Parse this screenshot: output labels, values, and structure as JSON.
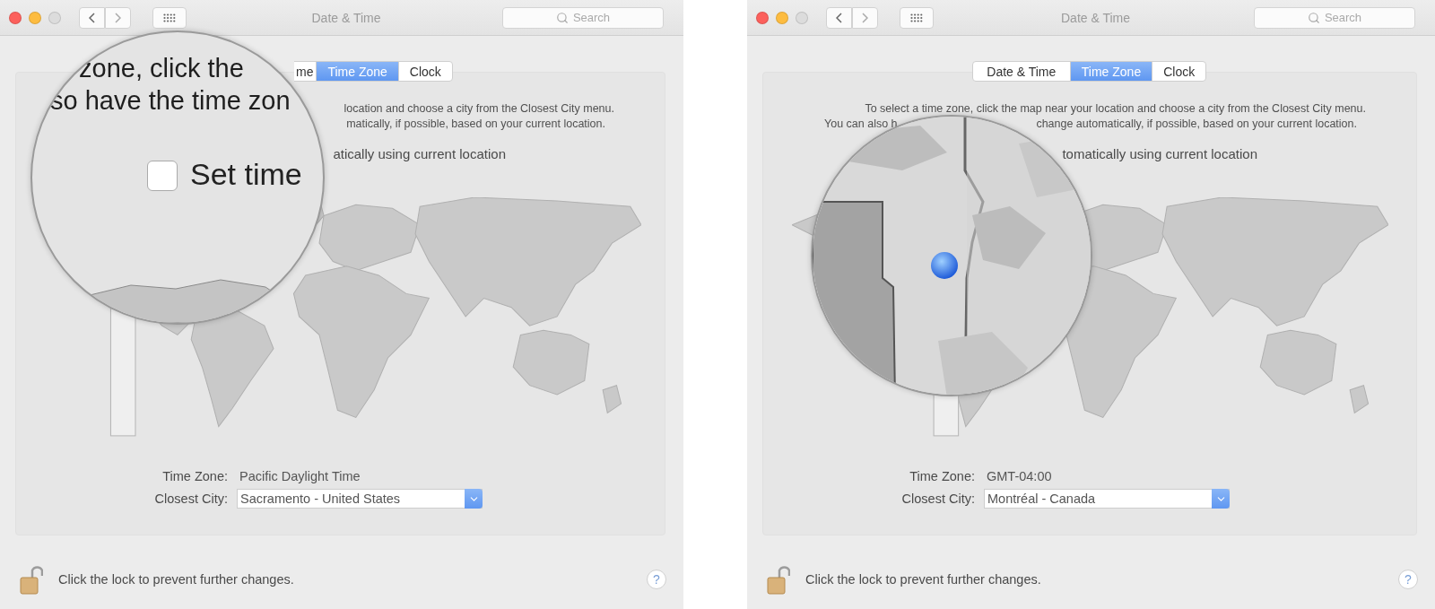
{
  "panes": [
    {
      "window": {
        "title": "Date & Time",
        "search_placeholder": "Search"
      },
      "tabs": [
        {
          "label": "me",
          "selected": false
        },
        {
          "label": "Time Zone",
          "selected": true
        },
        {
          "label": "Clock",
          "selected": false
        }
      ],
      "description": [
        [
          "location and choose a city from the Closest City menu."
        ],
        [
          "matically, if possible, based on your current location."
        ]
      ],
      "auto_location": "atically using current location",
      "time_zone": {
        "label": "Time Zone:",
        "value": "Pacific Daylight Time"
      },
      "closest_city": {
        "label": "Closest City:",
        "value": "Sacramento - United States"
      },
      "lock_text": "Click the lock to prevent further changes.",
      "help": "?",
      "magnifier": {
        "kind": "text",
        "lines": [
          "zone, click the",
          "so have the time zon"
        ],
        "checkbox": {
          "label": "Set time",
          "checked": false
        }
      }
    },
    {
      "window": {
        "title": "Date & Time",
        "search_placeholder": "Search"
      },
      "tabs": [
        {
          "label": "Date & Time",
          "selected": false
        },
        {
          "label": "Time Zone",
          "selected": true
        },
        {
          "label": "Clock",
          "selected": false
        }
      ],
      "description": [
        [
          "To select a time zone, click the map near your location and choose a city from the Closest City menu."
        ],
        [
          "You can also h",
          "change automatically, if possible, based on your current location."
        ]
      ],
      "auto_location": "tomatically using current location",
      "time_zone": {
        "label": "Time Zone:",
        "value": "GMT-04:00"
      },
      "closest_city": {
        "label": "Closest City:",
        "value": "Montréal - Canada"
      },
      "lock_text": "Click the lock to prevent further changes.",
      "help": "?",
      "magnifier": {
        "kind": "map"
      }
    }
  ]
}
